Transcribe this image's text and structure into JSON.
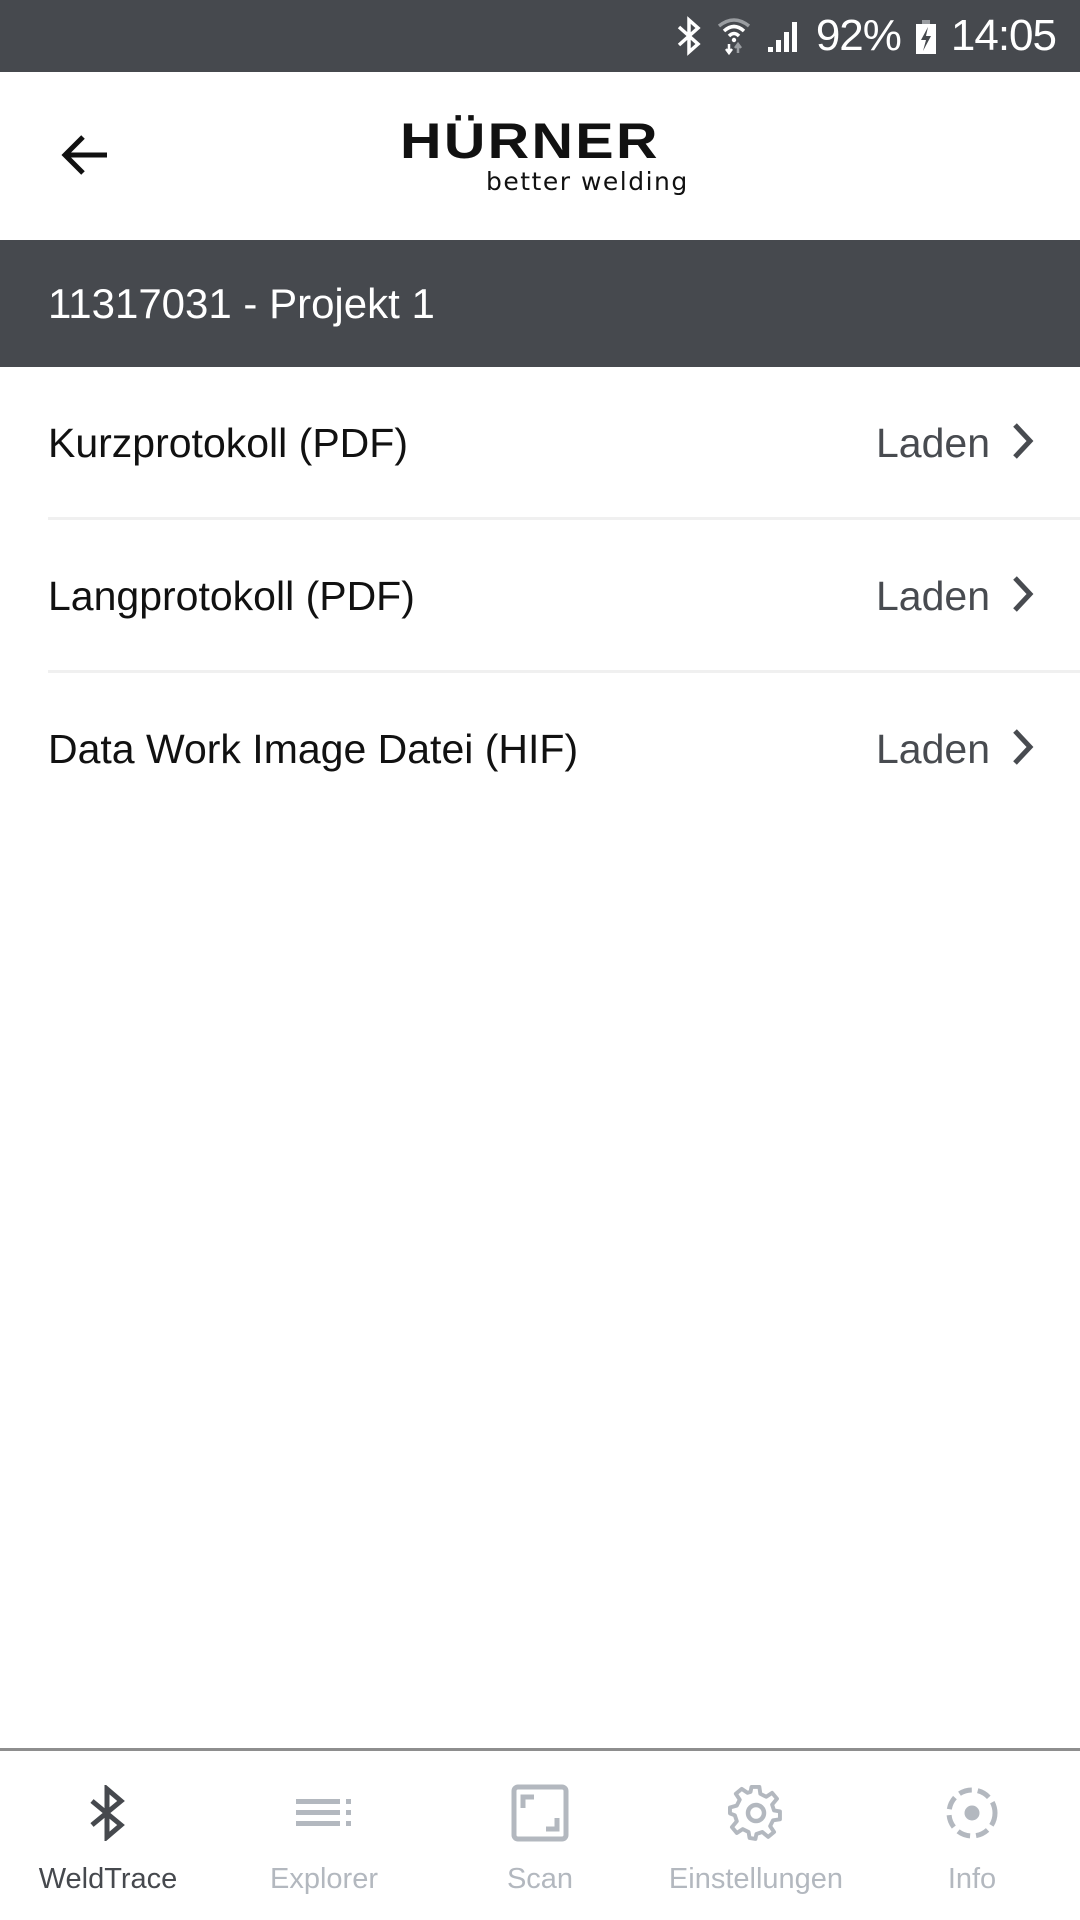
{
  "status_bar": {
    "icons": [
      "bluetooth-icon",
      "wifi-icon",
      "signal-icon",
      "battery-charging-icon"
    ],
    "battery": "92%",
    "time": "14:05"
  },
  "header": {
    "back_icon": "arrow-left-icon",
    "logo": {
      "brand": "HÜRNER",
      "tagline": "better welding"
    }
  },
  "project": {
    "title": "11317031 - Projekt 1"
  },
  "files": [
    {
      "label": "Kurzprotokoll (PDF)",
      "action": "Laden",
      "icon": "chevron-right-icon"
    },
    {
      "label": "Langprotokoll (PDF)",
      "action": "Laden",
      "icon": "chevron-right-icon"
    },
    {
      "label": "Data Work Image Datei (HIF)",
      "action": "Laden",
      "icon": "chevron-right-icon"
    }
  ],
  "bottom_nav": {
    "items": [
      {
        "label": "WeldTrace",
        "icon": "bluetooth-icon",
        "active": true
      },
      {
        "label": "Explorer",
        "icon": "list-icon",
        "active": false
      },
      {
        "label": "Scan",
        "icon": "scan-frame-icon",
        "active": false
      },
      {
        "label": "Einstellungen",
        "icon": "gear-icon",
        "active": false
      },
      {
        "label": "Info",
        "icon": "info-circle-icon",
        "active": false
      }
    ]
  },
  "colors": {
    "dark_band": "#46494e",
    "active_nav": "#46494e",
    "inactive_nav": "#b3b8bf",
    "divider": "#f0f0f0"
  }
}
